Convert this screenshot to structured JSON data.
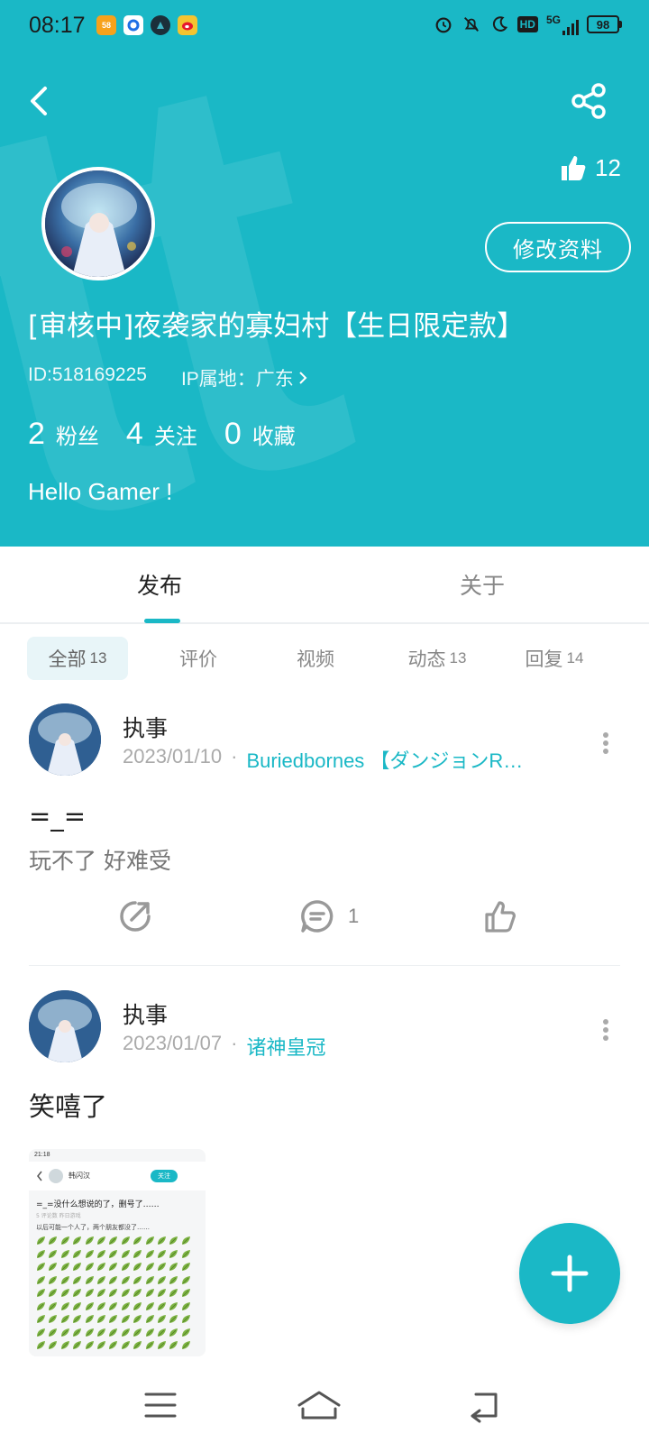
{
  "status_bar": {
    "time": "08:17",
    "battery": "98",
    "network": "5G",
    "hd": "HD",
    "app_icons": [
      "58-icon",
      "circle-app-icon",
      "compass-app-icon",
      "weibo-icon"
    ]
  },
  "header": {
    "like_count": "12",
    "edit_button": "修改资料",
    "username": "[审核中]夜袭家的寡妇村【生日限定款】",
    "user_id": "ID:518169225",
    "ip_location": "IP属地：广东",
    "stats": [
      {
        "num": "2",
        "label": "粉丝"
      },
      {
        "num": "4",
        "label": "关注"
      },
      {
        "num": "0",
        "label": "收藏"
      }
    ],
    "bio": "Hello Gamer !"
  },
  "tabs": [
    "发布",
    "关于"
  ],
  "filters": [
    {
      "label": "全部",
      "count": "13"
    },
    {
      "label": "评价",
      "count": ""
    },
    {
      "label": "视频",
      "count": ""
    },
    {
      "label": "动态",
      "count": "13"
    },
    {
      "label": "回复",
      "count": "14"
    }
  ],
  "posts": [
    {
      "author": "执事",
      "date": "2023/01/10",
      "dot": "·",
      "game": "Buriedbornes 【ダンジョンR…",
      "title": "=_=",
      "body": "玩不了 好难受",
      "comments": "1"
    },
    {
      "author": "执事",
      "date": "2023/01/07",
      "dot": "·",
      "game": "诸神皇冠",
      "title": "笑嘻了",
      "thumb": {
        "status_time": "21:18",
        "user": "韩闪汉",
        "follow": "关注",
        "title": "=_=没什么想说的了，删号了……",
        "meta": "5 评论数  昨日游戏",
        "line": "以后可能一个人了，两个朋友都没了……"
      }
    }
  ],
  "colors": {
    "accent": "#1ab8c6",
    "link": "#1ab8c6"
  }
}
